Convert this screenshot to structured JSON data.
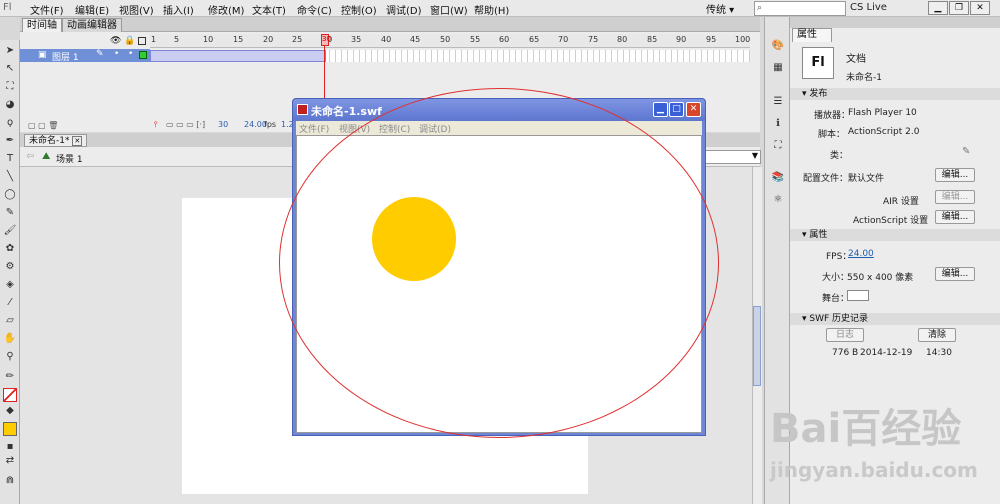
{
  "menubar": {
    "app_icon": "Fl",
    "items": [
      "文件(F)",
      "编辑(E)",
      "视图(V)",
      "插入(I)",
      "修改(M)",
      "文本(T)",
      "命令(C)",
      "控制(O)",
      "调试(D)",
      "窗口(W)",
      "帮助(H)"
    ],
    "workspace": "传统 ▾",
    "search_placeholder": "",
    "cs_live": "CS Live"
  },
  "timeline": {
    "tab_timeline": "时间轴",
    "tab_motion": "动画编辑器",
    "layer_name": "图层 1",
    "ruler_ticks": [
      "1",
      "5",
      "10",
      "15",
      "20",
      "25",
      "30",
      "35",
      "40",
      "45",
      "50",
      "55",
      "60",
      "65",
      "70",
      "75",
      "80",
      "85",
      "90",
      "95",
      "100"
    ],
    "current_frame": "30",
    "fps": "24.00",
    "fps_unit": "fps",
    "time": "1.2"
  },
  "document": {
    "tab": "未命名-1*",
    "scene": "场景 1"
  },
  "swf_window": {
    "title": "未命名-1.swf",
    "menu": [
      "文件(F)",
      "视图(V)",
      "控制(C)",
      "调试(D)"
    ]
  },
  "shapes": {
    "circle_color": "#ffcc00",
    "ellipse_stroke": "#e03030"
  },
  "properties": {
    "tab": "属性",
    "doc_label": "文档",
    "doc_name": "未命名-1",
    "section_publish": "发布",
    "player_label": "播放器：",
    "player_value": "Flash Player 10",
    "script_label": "脚本：",
    "script_value": "ActionScript 2.0",
    "class_label": "类：",
    "profile_label": "配置文件：",
    "profile_value": "默认文件",
    "edit": "编辑...",
    "air_label": "AIR 设置",
    "as_label": "ActionScript 设置",
    "section_props": "属性",
    "fps_label": "FPS：",
    "fps_value": "24.00",
    "size_label": "大小：",
    "size_value": "550 x 400 像素",
    "stage_label": "舞台：",
    "section_history": "SWF 历史记录",
    "log_btn": "日志",
    "clear_btn": "清除",
    "history_size": "776 B",
    "history_date": "2014-12-19",
    "history_time": "14:30"
  },
  "watermark": {
    "brand": "Bai百经验",
    "url": "jingyan.baidu.com"
  }
}
